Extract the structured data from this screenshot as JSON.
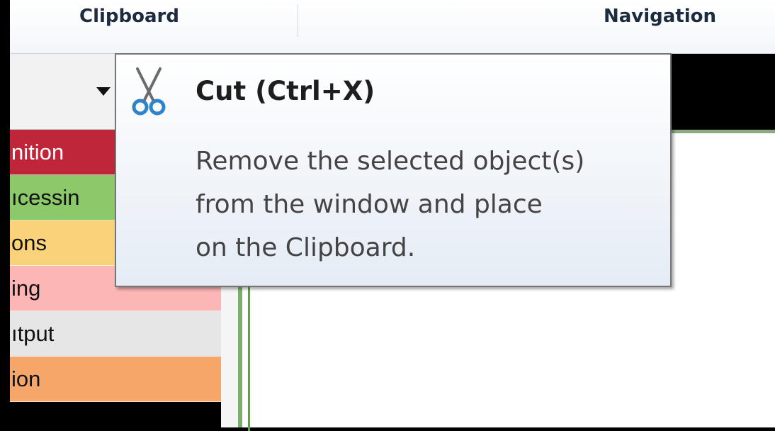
{
  "ribbon": {
    "groups": [
      {
        "label": "Clipboard"
      },
      {
        "label": "Navigation"
      }
    ]
  },
  "category_list": {
    "items": [
      {
        "label": "nition",
        "color": "#c0263a"
      },
      {
        "label": "ıcessin",
        "color": "#8bc96b"
      },
      {
        "label": "ons",
        "color": "#f9d27a"
      },
      {
        "label": "ing",
        "color": "#fbb6b5"
      },
      {
        "label": "ıtput",
        "color": "#e6e6e6"
      },
      {
        "label": "ion",
        "color": "#f7a66a"
      }
    ]
  },
  "tooltip": {
    "icon": "scissors-icon",
    "title": "Cut (Ctrl+X)",
    "description_lines": [
      "Remove the selected object(s)",
      "from the window and place",
      "on the Clipboard."
    ]
  },
  "colors": {
    "accent_green": "#7ab06a",
    "scissors_blade": "#6b6b6b",
    "scissors_handle": "#2f83c8"
  }
}
